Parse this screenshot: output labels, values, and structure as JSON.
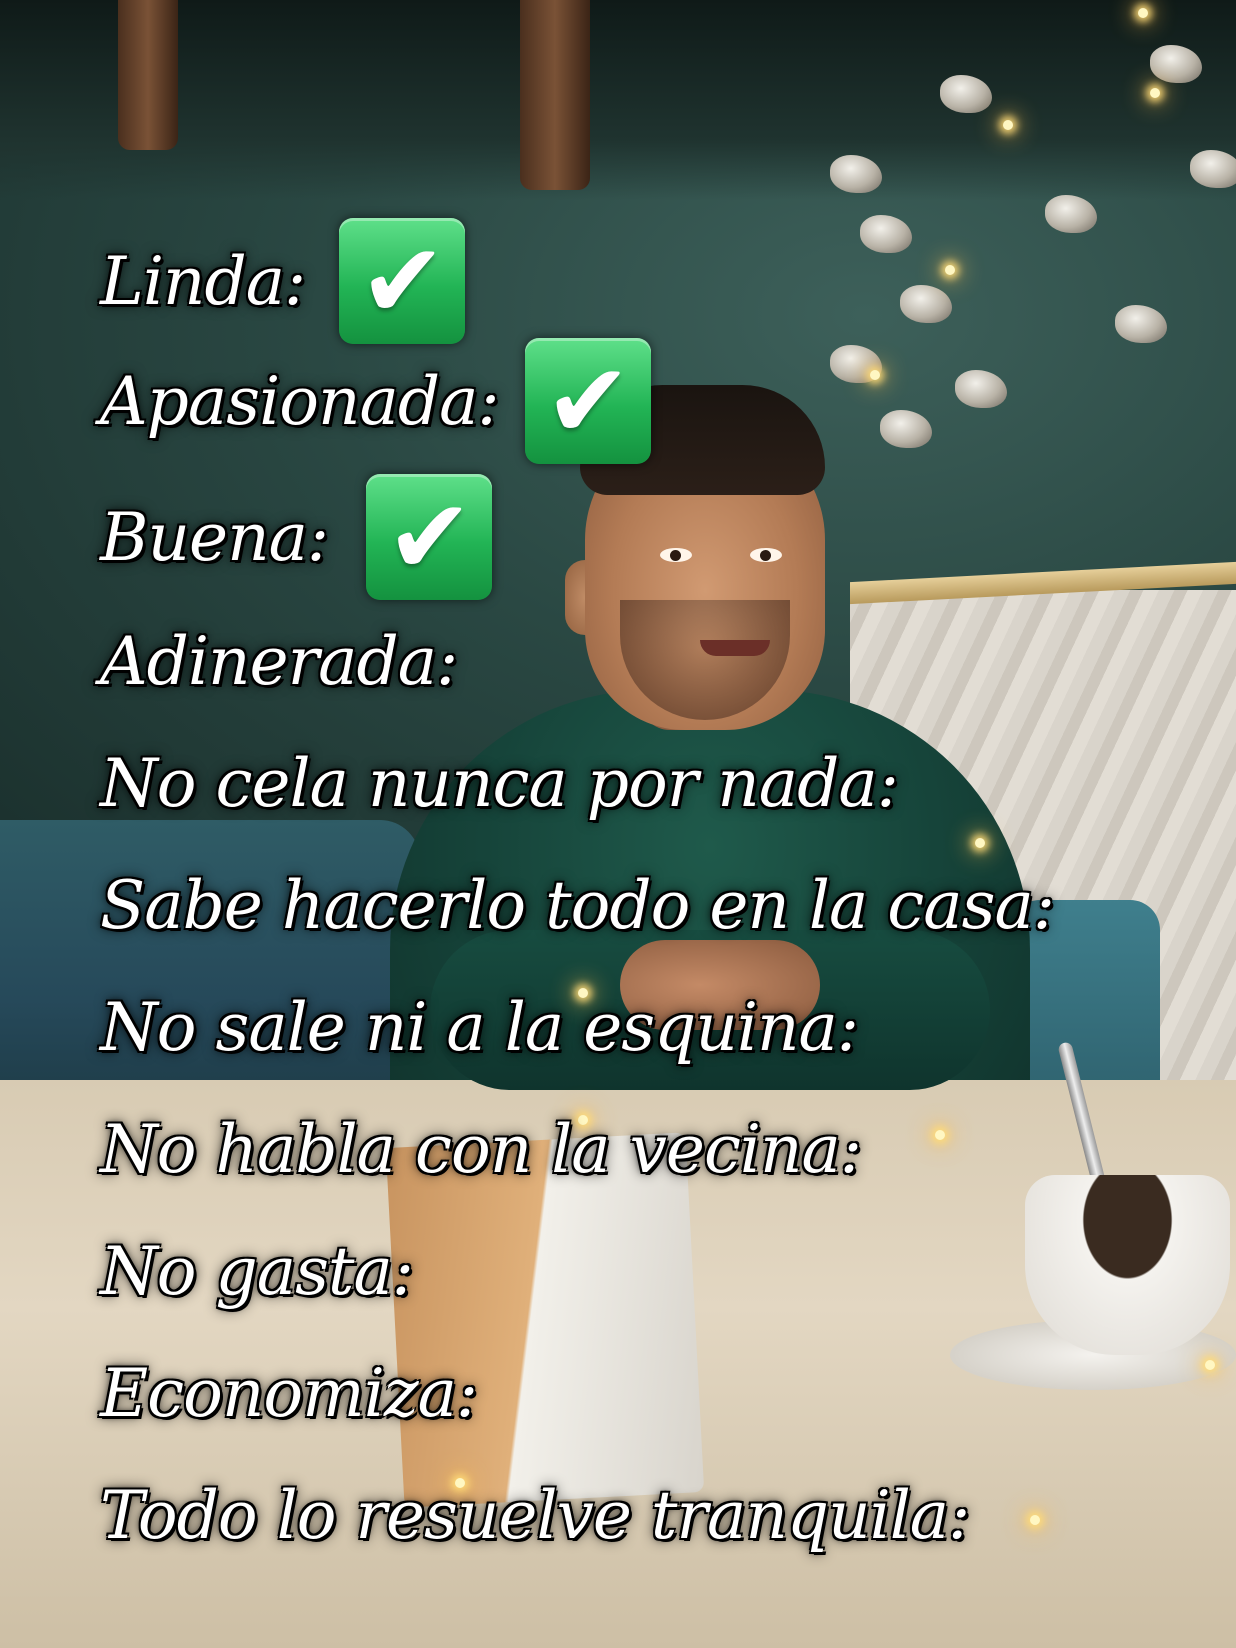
{
  "overlay": {
    "lines": [
      {
        "text": "Linda:",
        "checked": true
      },
      {
        "text": "Apasionada:",
        "checked": true
      },
      {
        "text": "Buena:",
        "checked": true
      },
      {
        "text": "Adinerada:",
        "checked": false
      },
      {
        "text": "No cela nunca por nada:",
        "checked": false
      },
      {
        "text": "Sabe hacerlo todo en la casa:",
        "checked": false
      },
      {
        "text": "No sale ni a la esquina:",
        "checked": false
      },
      {
        "text": "No habla con la vecina:",
        "checked": false
      },
      {
        "text": "No gasta:",
        "checked": false
      },
      {
        "text": "Economiza:",
        "checked": false
      },
      {
        "text": "Todo lo resuelve tranquila:",
        "checked": false
      }
    ],
    "check_icon": "check-mark-button-icon",
    "check_color": "#22b455",
    "text_color": "#ffffff"
  }
}
